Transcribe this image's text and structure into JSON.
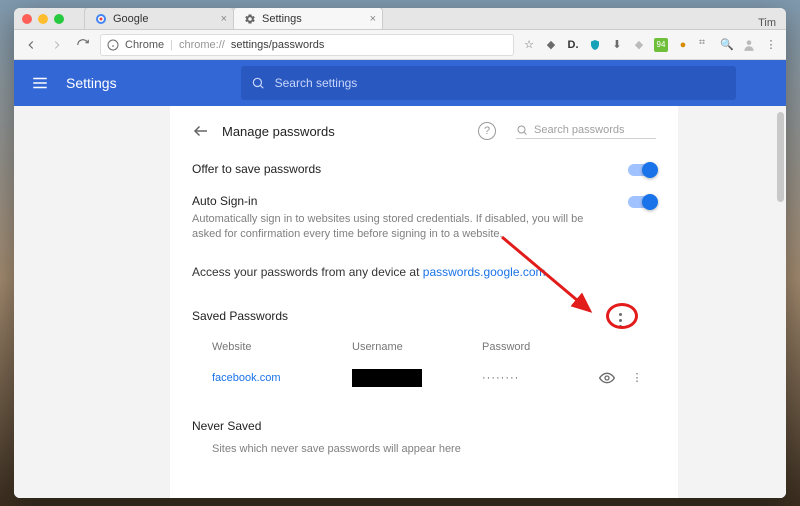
{
  "macos": {
    "user": "Tim"
  },
  "browser_tabs": [
    {
      "label": "Google",
      "active": false
    },
    {
      "label": "Settings",
      "active": true
    }
  ],
  "address_bar": {
    "scheme_label": "Chrome",
    "path_dim": "chrome://",
    "path_main": "settings/passwords"
  },
  "toolbar_badge": "94",
  "bluebar": {
    "title": "Settings",
    "search_placeholder": "Search settings"
  },
  "card": {
    "title": "Manage passwords",
    "search_placeholder": "Search passwords",
    "offer_label": "Offer to save passwords",
    "auto_signin_label": "Auto Sign-in",
    "auto_signin_desc": "Automatically sign in to websites using stored credentials. If disabled, you will be asked for confirmation every time before signing in to a website.",
    "access_prefix": "Access your passwords from any device at ",
    "access_link": "passwords.google.com",
    "saved_title": "Saved Passwords",
    "columns": {
      "website": "Website",
      "username": "Username",
      "password": "Password"
    },
    "rows": [
      {
        "website": "facebook.com",
        "username_redacted": true,
        "password_mask": "········"
      }
    ],
    "never_title": "Never Saved",
    "never_desc": "Sites which never save passwords will appear here"
  }
}
